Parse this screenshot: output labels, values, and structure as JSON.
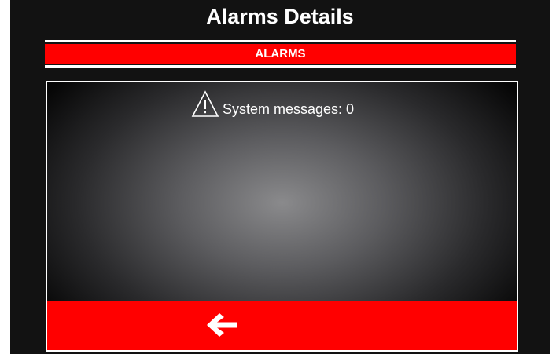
{
  "header": {
    "title": "Alarms Details"
  },
  "alarms_bar": {
    "label": "ALARMS"
  },
  "panel": {
    "system_messages_label": "System messages: 0",
    "warning_icon": "warning-triangle-icon"
  },
  "footer": {
    "back_icon": "arrow-left-icon"
  },
  "colors": {
    "accent_red": "#ff0000",
    "background": "#121212",
    "text": "#ffffff"
  }
}
